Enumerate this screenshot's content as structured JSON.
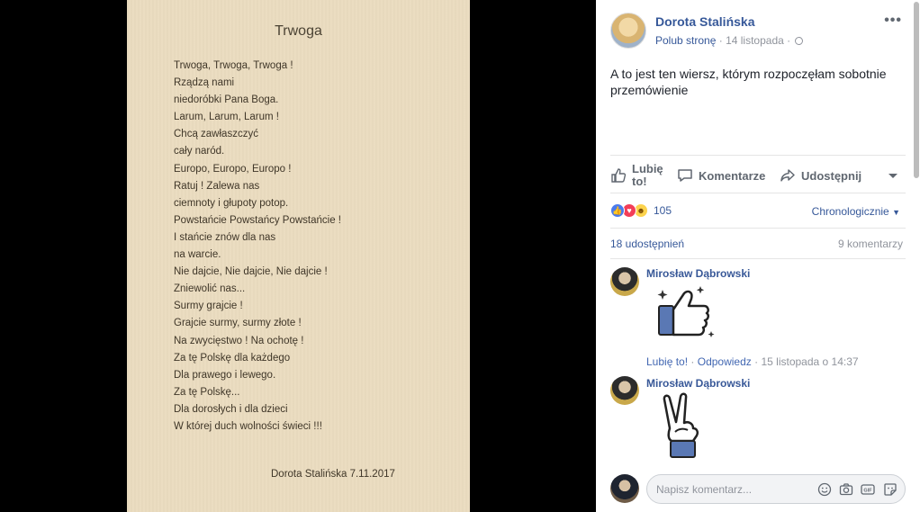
{
  "poem": {
    "title": "Trwoga",
    "lines": [
      "Trwoga, Trwoga, Trwoga !",
      "Rządzą nami",
      "niedoróbki Pana Boga.",
      "Larum, Larum, Larum !",
      "Chcą zawłaszczyć",
      "cały naród.",
      "Europo, Europo, Europo !",
      "Ratuj ! Zalewa nas",
      "ciemnoty i głupoty potop.",
      "Powstańcie Powstańcy Powstańcie !",
      "I stańcie znów dla nas",
      "na warcie.",
      "Nie dajcie, Nie dajcie, Nie dajcie !",
      "Zniewolić nas...",
      "Surmy grajcie !",
      "Grajcie surmy, surmy złote !",
      "Na zwycięstwo ! Na ochotę !",
      "Za tę Polskę dla każdego",
      "Dla prawego i lewego.",
      "Za tę Polskę...",
      "Dla dorosłych i dla dzieci",
      "W której duch wolności świeci !!!"
    ],
    "signature": "Dorota Stalińska 7.11.2017"
  },
  "post": {
    "author": "Dorota Stalińska",
    "like_page": "Polub stronę",
    "date": "14 listopada",
    "dot": "·",
    "text": "A to jest ten wiersz, którym rozpoczęłam sobotnie przemówienie",
    "more": "•••"
  },
  "actions": {
    "like": "Lubię to!",
    "comment": "Komentarze",
    "share": "Udostępnij"
  },
  "stats": {
    "reaction_count": "105",
    "sort": "Chronologicznie",
    "shares": "18 udostępnień",
    "comments": "9 komentarzy"
  },
  "comments": [
    {
      "name": "Mirosław Dąbrowski",
      "like": "Lubię to!",
      "reply": "Odpowiedz",
      "sep": "·",
      "time": "15 listopada o 14:37"
    },
    {
      "name": "Mirosław Dąbrowski"
    }
  ],
  "composer": {
    "placeholder": "Napisz komentarz..."
  },
  "icons": {
    "globe": "globe-icon",
    "like": "thumbs-up-icon",
    "comment": "speech-bubble-icon",
    "share": "share-arrow-icon",
    "emoji": "emoji-icon",
    "camera": "camera-icon",
    "gif": "gif-icon",
    "sticker": "sticker-icon"
  },
  "colors": {
    "link": "#365899",
    "muted": "#90949c",
    "paper": "#ebdcc0"
  }
}
